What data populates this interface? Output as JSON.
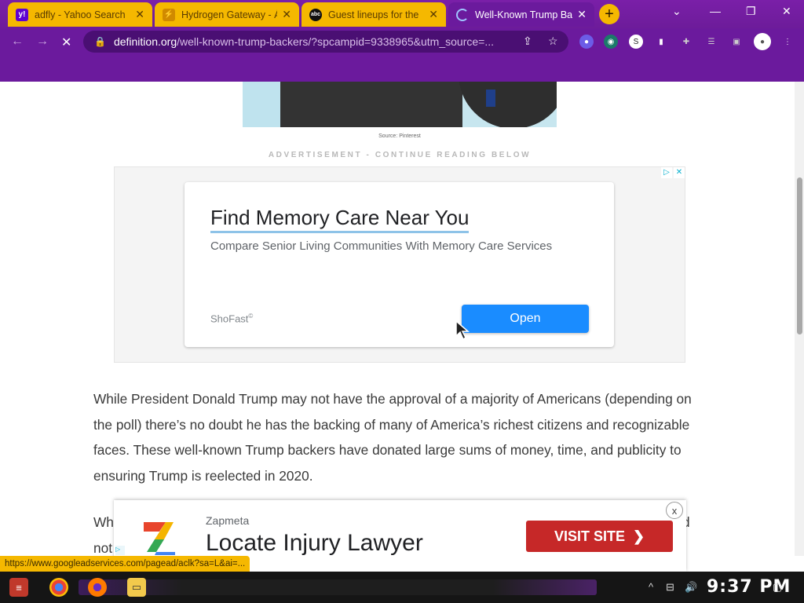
{
  "browser": {
    "tabs": [
      {
        "title": "adfly - Yahoo Search",
        "favicon": "yahoo-icon",
        "state": "inactive"
      },
      {
        "title": "Hydrogen Gateway - Á",
        "favicon": "hydrogen-icon",
        "state": "inactive"
      },
      {
        "title": "Guest lineups for the",
        "favicon": "abc-icon",
        "state": "inactive"
      },
      {
        "title": "Well-Known Trump Ba",
        "favicon": "loading-icon",
        "state": "active"
      }
    ],
    "new_tab": "+",
    "url_host": "definition.org",
    "url_path": "/well-known-trump-backers/?spcampid=9338965&utm_source=..."
  },
  "page": {
    "image_caption": "Source: Pinterest",
    "ad_label": "ADVERTISEMENT - CONTINUE READING BELOW",
    "ad": {
      "title": "Find Memory Care Near You",
      "description": "Compare Senior Living Communities With Memory Care Services",
      "brand": "ShoFast",
      "button": "Open"
    },
    "article": {
      "paragraph1": "While President Donald Trump may not have the approval of a majority of Americans (depending on the poll) there’s no doubt he has the backing of many of America’s richest citizens and recognizable faces. These well-known Trump backers have donated large sums of money, time, and publicity to ensuring Trump is reelected in 2020.",
      "paragraph2_partial": "Wh",
      "paragraph2_end": "d",
      "paragraph3_partial": "not"
    },
    "sticky_ad": {
      "brand": "Zapmeta",
      "headline": "Locate Injury Lawyer",
      "button": "VISIT SITE",
      "close": "x"
    }
  },
  "status_url": "https://www.googleadservices.com/pagead/aclk?sa=L&ai=...",
  "taskbar": {
    "clock": "9:37 PM"
  },
  "colors": {
    "browser_frame": "#6b1a9d",
    "tab_accent": "#f5b800",
    "ad_button": "#1a8cff",
    "visit_button": "#c62828"
  }
}
